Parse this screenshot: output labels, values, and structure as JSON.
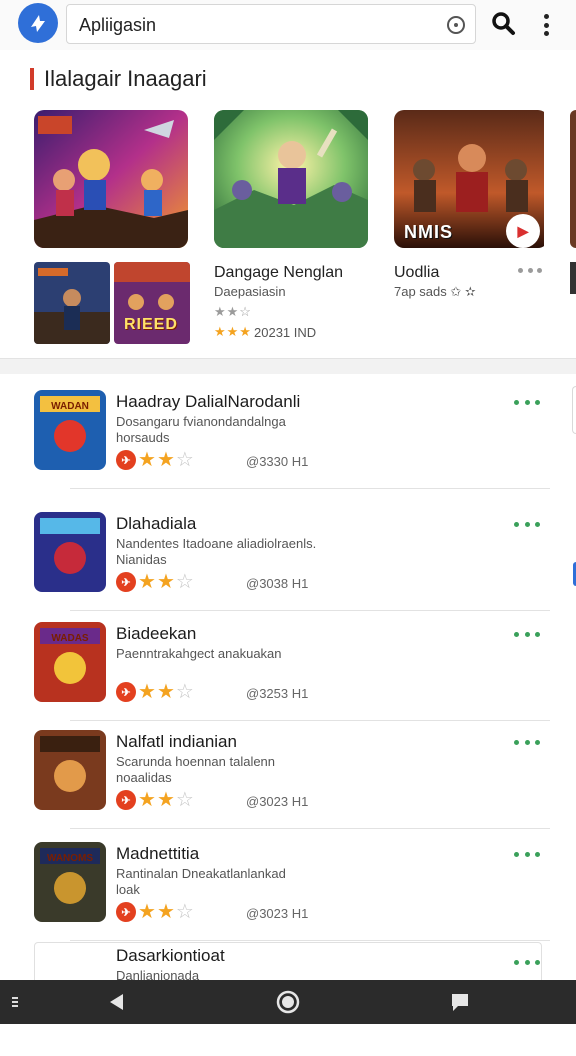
{
  "search": {
    "query": "Apliigasin"
  },
  "section": {
    "title": "Ilalagair Inaagari"
  },
  "featured": [
    {
      "thumb_label": ""
    },
    {
      "title": "Dangage Nenglan",
      "subtitle": "Daepasiasin",
      "stars": "★★☆",
      "extra_line": "★★★",
      "meta": "20231 IND"
    },
    {
      "title": "Uodlia",
      "subtitle": "7ap sads ✩ ✫",
      "thumb_label": "NMIS"
    }
  ],
  "small_thumbs": [
    {
      "label": ""
    },
    {
      "label": "RIEED"
    }
  ],
  "list": [
    {
      "title": "Haadray DalialNarodanli",
      "line1": "Dosangaru fvianondandalnga",
      "line2": "horsauds",
      "meta": "@3330 H1",
      "icon_label": "WADAN"
    },
    {
      "title": "Dlahadiala",
      "line1": "Nandentes Itadoane aliadiolraenls.",
      "line2": "Nianidas",
      "meta": "@3038 H1",
      "icon_label": ""
    },
    {
      "title": "Biadeekan",
      "line1": "Paenntrakahgect anakuakan",
      "line2": "",
      "meta": "@3253 H1",
      "icon_label": "WADAS"
    },
    {
      "title": "Nalfatl indianian",
      "line1": "Scarunda hoennan talalenn",
      "line2": "noaalidas",
      "meta": "@3023 H1",
      "icon_label": ""
    },
    {
      "title": "Madnettitia",
      "line1": "Rantinalan Dneakatlanlankad",
      "line2": "loak",
      "meta": "@3023 H1",
      "icon_label": "WANOMS"
    },
    {
      "title": "Dasarkiontioat",
      "line1": "Danlianionada",
      "line2": "",
      "meta": "",
      "icon_label": ""
    }
  ],
  "rating_badge": "✈",
  "colors": {
    "accent_red": "#d23b2a",
    "star": "#f4a320",
    "more_green": "#3aa05a",
    "nav_bg": "#2b2b2b",
    "logo_blue": "#2f6fd8"
  }
}
